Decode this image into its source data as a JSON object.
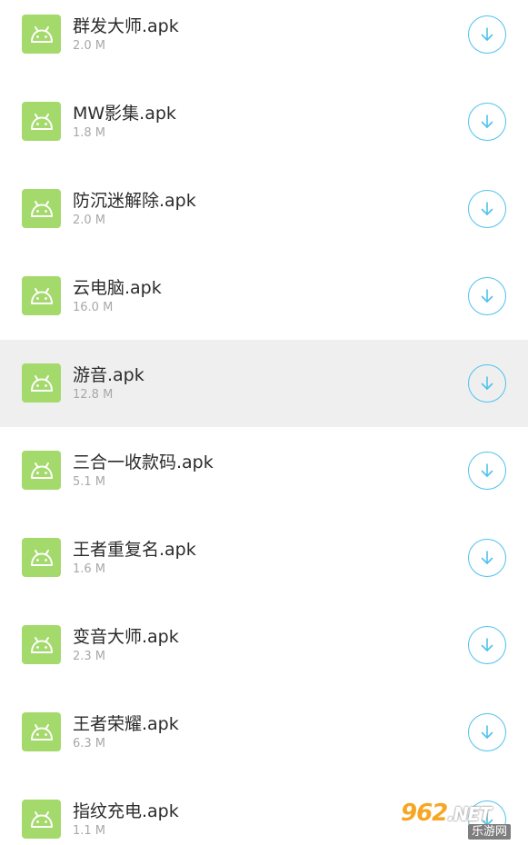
{
  "files": [
    {
      "name": "群发大师.apk",
      "size": "2.0 M",
      "selected": false
    },
    {
      "name": "MW影集.apk",
      "size": "1.8 M",
      "selected": false
    },
    {
      "name": "防沉迷解除.apk",
      "size": "2.0 M",
      "selected": false
    },
    {
      "name": "云电脑.apk",
      "size": "16.0 M",
      "selected": false
    },
    {
      "name": "游音.apk",
      "size": "12.8 M",
      "selected": true
    },
    {
      "name": "三合一收款码.apk",
      "size": "5.1 M",
      "selected": false
    },
    {
      "name": "王者重复名.apk",
      "size": "1.6 M",
      "selected": false
    },
    {
      "name": "变音大师.apk",
      "size": "2.3 M",
      "selected": false
    },
    {
      "name": "王者荣耀.apk",
      "size": "6.3 M",
      "selected": false
    },
    {
      "name": "指纹充电.apk",
      "size": "1.1 M",
      "selected": false
    }
  ],
  "icons": {
    "file_icon": "android-icon",
    "action_icon": "download-icon"
  },
  "colors": {
    "android_green": "#a4d96c",
    "download_blue": "#4fc2ec",
    "selected_row": "#efefef"
  },
  "watermark": {
    "brand": "962",
    "domain": ".NET",
    "caption": "乐游网"
  }
}
